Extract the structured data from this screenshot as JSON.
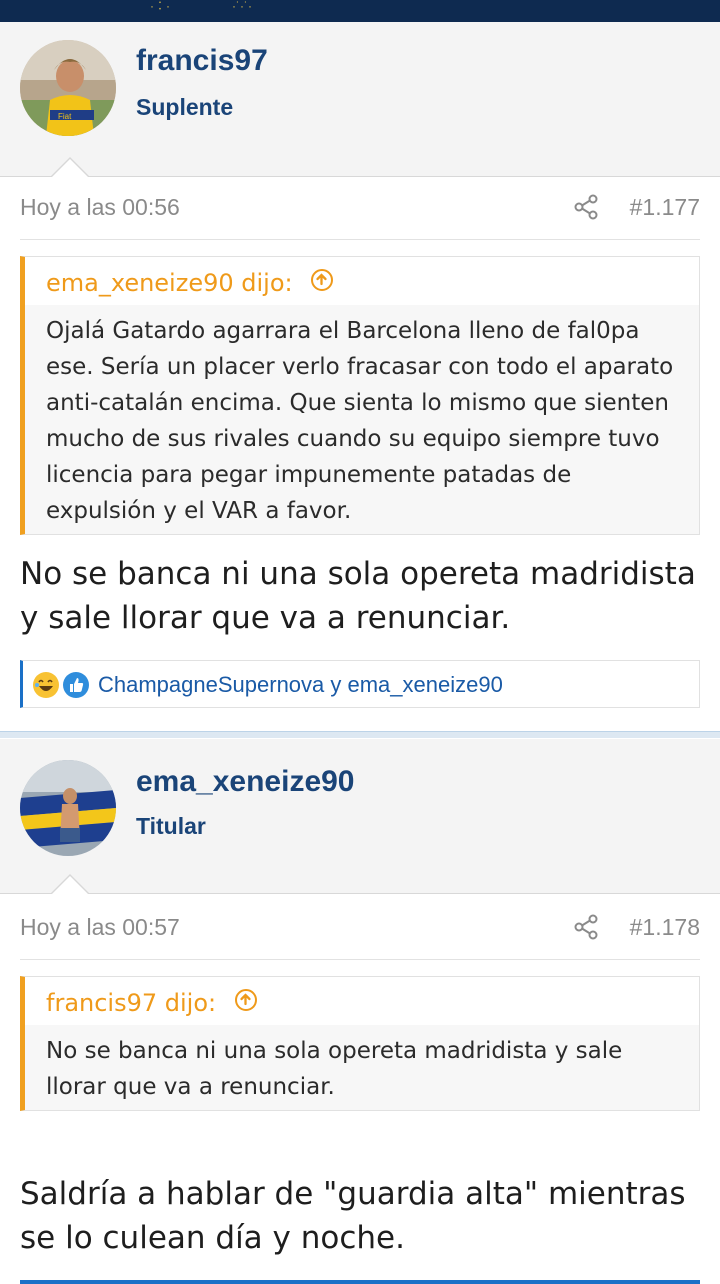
{
  "posts": [
    {
      "username": "francis97",
      "rank": "Suplente",
      "time": "Hoy a las 00:56",
      "number": "#1.177",
      "quote": {
        "author": "ema_xeneize90 dijo:",
        "text": "Ojalá Gatardo agarrara el Barcelona lleno de fal0pa ese. Sería un placer verlo fracasar con todo el aparato anti-catalán encima. Que sienta lo mismo que sienten mucho de sus rivales cuando su equipo siempre tuvo licencia para pegar impunemente patadas de expulsión y el VAR a favor."
      },
      "body": "No se banca ni una sola opereta madridista y sale llorar que va a renunciar.",
      "reactions": {
        "names": "ChampagneSupernova y ema_xeneize90",
        "icons": [
          "laughing-emoji-icon",
          "like-icon"
        ]
      }
    },
    {
      "username": "ema_xeneize90",
      "rank": "Titular",
      "time": "Hoy a las 00:57",
      "number": "#1.178",
      "quote": {
        "author": "francis97 dijo:",
        "text": "No se banca ni una sola opereta madridista y sale llorar que va a renunciar."
      },
      "body": "Saldría a hablar de \"guardia alta\" mientras se lo culean día y noche."
    }
  ],
  "colors": {
    "header": "#0e2a50",
    "username": "#1a4478",
    "quote_accent": "#ef9a1a",
    "link": "#1a5aa6"
  }
}
